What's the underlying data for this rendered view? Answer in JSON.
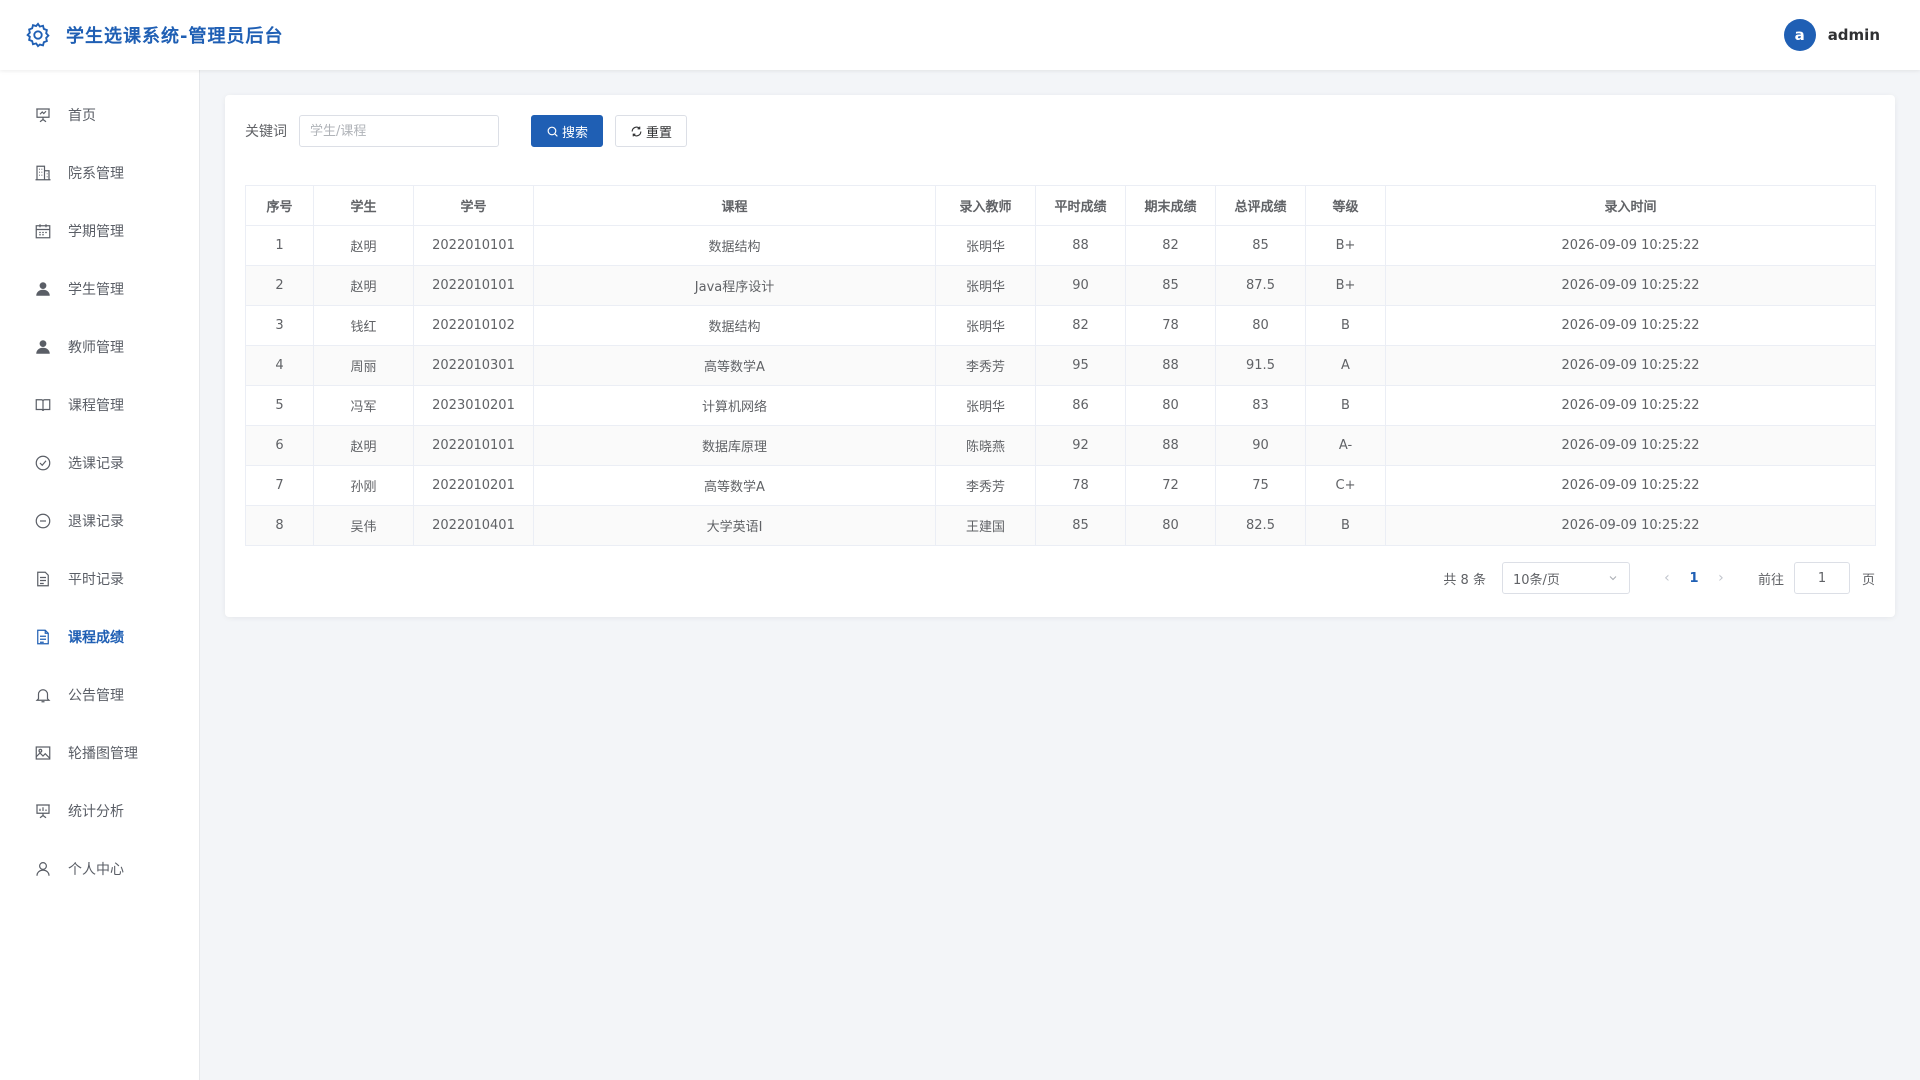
{
  "header": {
    "title": "学生选课系统-管理员后台",
    "avatar_letter": "a",
    "username": "admin"
  },
  "sidebar": {
    "items": [
      {
        "label": "首页",
        "icon": "presentation-icon"
      },
      {
        "label": "院系管理",
        "icon": "office-building-icon"
      },
      {
        "label": "学期管理",
        "icon": "calendar-icon"
      },
      {
        "label": "学生管理",
        "icon": "user-solid-icon"
      },
      {
        "label": "教师管理",
        "icon": "user-solid-icon"
      },
      {
        "label": "课程管理",
        "icon": "book-icon"
      },
      {
        "label": "选课记录",
        "icon": "circle-check-icon"
      },
      {
        "label": "退课记录",
        "icon": "circle-minus-icon"
      },
      {
        "label": "平时记录",
        "icon": "document-icon"
      },
      {
        "label": "课程成绩",
        "icon": "document-lines-icon"
      },
      {
        "label": "公告管理",
        "icon": "bell-icon"
      },
      {
        "label": "轮播图管理",
        "icon": "picture-icon"
      },
      {
        "label": "统计分析",
        "icon": "data-board-icon"
      },
      {
        "label": "个人中心",
        "icon": "user-icon"
      }
    ],
    "active_index": 9
  },
  "search": {
    "label": "关键词",
    "placeholder": "学生/课程",
    "value": "",
    "search_button": "搜索",
    "reset_button": "重置"
  },
  "table": {
    "columns": [
      "序号",
      "学生",
      "学号",
      "课程",
      "录入教师",
      "平时成绩",
      "期末成绩",
      "总评成绩",
      "等级",
      "录入时间"
    ],
    "rows": [
      [
        "1",
        "赵明",
        "2022010101",
        "数据结构",
        "张明华",
        "88",
        "82",
        "85",
        "B+",
        "2026-09-09 10:25:22"
      ],
      [
        "2",
        "赵明",
        "2022010101",
        "Java程序设计",
        "张明华",
        "90",
        "85",
        "87.5",
        "B+",
        "2026-09-09 10:25:22"
      ],
      [
        "3",
        "钱红",
        "2022010102",
        "数据结构",
        "张明华",
        "82",
        "78",
        "80",
        "B",
        "2026-09-09 10:25:22"
      ],
      [
        "4",
        "周丽",
        "2022010301",
        "高等数学A",
        "李秀芳",
        "95",
        "88",
        "91.5",
        "A",
        "2026-09-09 10:25:22"
      ],
      [
        "5",
        "冯军",
        "2023010201",
        "计算机网络",
        "张明华",
        "86",
        "80",
        "83",
        "B",
        "2026-09-09 10:25:22"
      ],
      [
        "6",
        "赵明",
        "2022010101",
        "数据库原理",
        "陈晓燕",
        "92",
        "88",
        "90",
        "A-",
        "2026-09-09 10:25:22"
      ],
      [
        "7",
        "孙刚",
        "2022010201",
        "高等数学A",
        "李秀芳",
        "78",
        "72",
        "75",
        "C+",
        "2026-09-09 10:25:22"
      ],
      [
        "8",
        "吴伟",
        "2022010401",
        "大学英语I",
        "王建国",
        "85",
        "80",
        "82.5",
        "B",
        "2026-09-09 10:25:22"
      ]
    ]
  },
  "pagination": {
    "total": "共 8 条",
    "page_size": "10条/页",
    "current_page": "1",
    "goto_label": "前往",
    "goto_value": "1",
    "page_suffix": "页"
  },
  "colors": {
    "primary": "#1f5fb4",
    "background": "#f3f5f8"
  }
}
